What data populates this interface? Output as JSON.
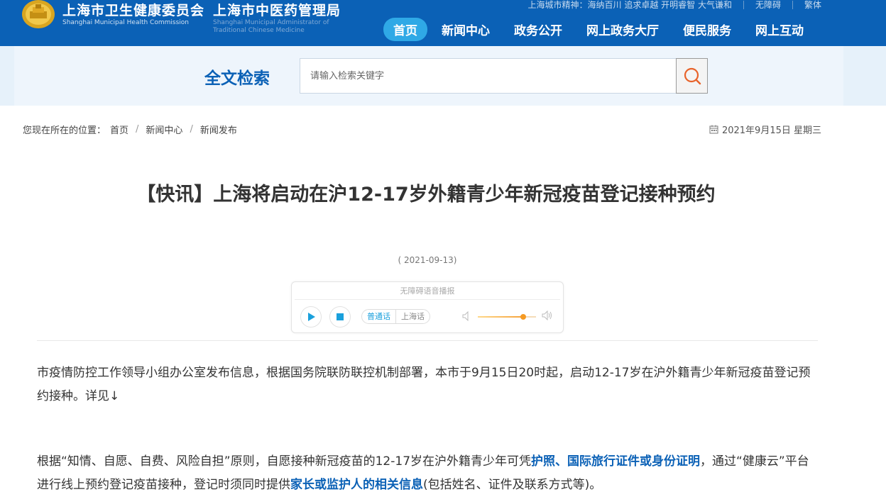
{
  "header": {
    "org_name": "上海市卫生健康委员会",
    "org_name_en": "Shanghai Municipal Health Commission",
    "org2_name": "上海市中医药管理局",
    "org2_name_en": "Shanghai Municipal Administrator of Traditional Chinese Medicine",
    "spirit": "上海城市精神：海纳百川 追求卓越 开明睿智 大气谦和",
    "accessibility_link": "无障碍",
    "traditional_link": "繁体",
    "brand_color": "#0b61b6",
    "nav_active_color": "#2fa9e6",
    "nav": [
      {
        "label": "首页",
        "active": true
      },
      {
        "label": "新闻中心",
        "active": false
      },
      {
        "label": "政务公开",
        "active": false
      },
      {
        "label": "网上政务大厅",
        "active": false
      },
      {
        "label": "便民服务",
        "active": false
      },
      {
        "label": "网上互动",
        "active": false
      }
    ]
  },
  "search": {
    "title": "全文检索",
    "placeholder": "请输入检索关键字",
    "button_icon": "search-icon",
    "icon_color": "#e8632a"
  },
  "breadcrumb": {
    "lead": "您现在所在的位置：",
    "items": [
      "首页",
      "新闻中心",
      "新闻发布"
    ]
  },
  "date": {
    "icon": "calendar-icon",
    "text": "2021年9月15日 星期三"
  },
  "article": {
    "title": "【快讯】上海将启动在沪12-17岁外籍青少年新冠疫苗登记接种预约",
    "pubdate": "( 2021-09-13)",
    "p1": "市疫情防控工作领导小组办公室发布信息，根据国务院联防联控机制部署，本市于9月15日20时起，启动12-17岁在沪外籍青少年新冠疫苗登记预约接种。详见↓",
    "p2": {
      "a": "根据“知情、自愿、自费、风险自担”原则，自愿接种新冠疫苗的12-17岁在沪外籍青少年可凭",
      "b": "护照、国际旅行证件或身份证明",
      "c": "，通过“健康云”平台进行线上预约登记疫苗接种，登记时须同时提供",
      "d": "家长或监护人的相关信息",
      "e": "(包括姓名、证件及联系方式等)。"
    }
  },
  "player": {
    "label": "无障碍语音播报",
    "play_icon": "play-icon",
    "stop_icon": "stop-icon",
    "dialect_on": "普通话",
    "dialect_off": "上海话",
    "volume_level": 0.78,
    "accent_color": "#1aa0dc"
  }
}
